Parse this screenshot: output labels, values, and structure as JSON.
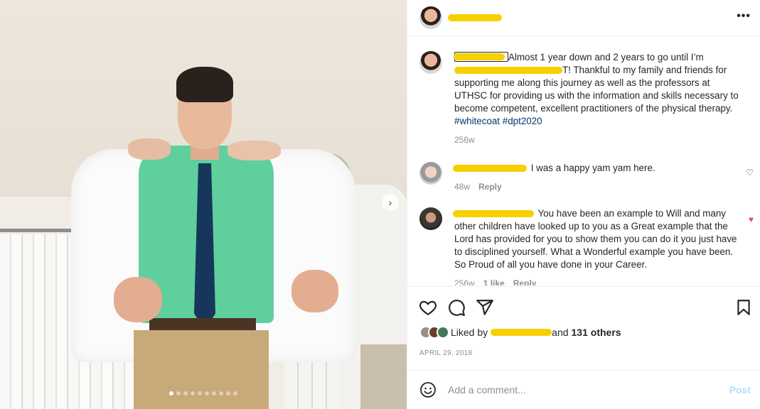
{
  "header": {
    "username": "",
    "more_icon": "more-horizontal-icon",
    "more_label": "•••"
  },
  "media": {
    "carousel_count": 10,
    "carousel_active": 0,
    "next_label": "›"
  },
  "caption": {
    "username": "",
    "text_parts": [
      "Almost 1 year down and 2 years to go until I’m ",
      "T! Thankful to my family and friends for supporting me along this journey as well as the professors at UTHSC for providing us with the information and skills necessary to become competent, excellent practitioners of the physical therapy. "
    ],
    "hashtags": [
      "#whitecoat",
      "#dpt2020"
    ],
    "time": "256w"
  },
  "comments": [
    {
      "username": "",
      "text": "I was a happy yam yam here.",
      "time": "48w",
      "reply_label": "Reply",
      "liked": false
    },
    {
      "username": "",
      "text": "You have been an example to Will and many other children have looked up to you as a Great example that the Lord has provided for you to show them you can do it you just have to disciplined yourself. What a Wonderful example you have been. So Proud of all you have done in your Career.",
      "time": "256w",
      "likes": "1 like",
      "reply_label": "Reply",
      "liked": true
    }
  ],
  "likes": {
    "prefix": "Liked by",
    "suffix": "and",
    "others": "131 others"
  },
  "date": "APRIL 29, 2018",
  "add_comment": {
    "placeholder": "Add a comment...",
    "post_label": "Post"
  },
  "colors": {
    "accent_link": "#00376b",
    "like_red": "#ed4956",
    "post_disabled": "#b2dffc",
    "redaction": "#f7d000"
  }
}
